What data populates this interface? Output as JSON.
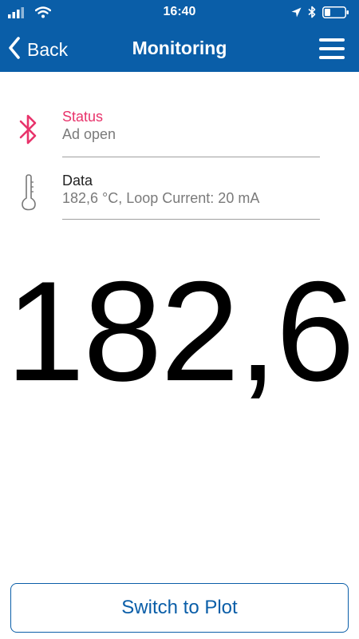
{
  "status_bar": {
    "time": "16:40"
  },
  "nav": {
    "back_label": "Back",
    "title": "Monitoring"
  },
  "status": {
    "label": "Status",
    "value": "Ad open"
  },
  "data_row": {
    "label": "Data",
    "value": "182,6 °C, Loop Current: 20 mA"
  },
  "reading": "182,6",
  "switch_button_label": "Switch to Plot",
  "colors": {
    "header_bg": "#0a5ea8",
    "status_accent": "#e8336b",
    "button_accent": "#0a5ea8"
  }
}
